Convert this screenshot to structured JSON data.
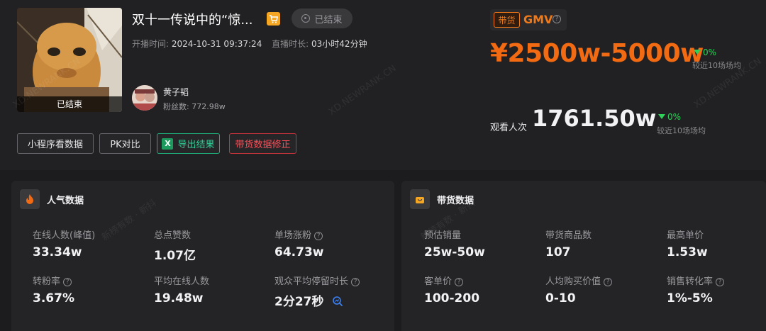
{
  "live": {
    "title": "双十一传说中的“惊...",
    "status": "已结束",
    "thumbnail_badge": "已结束",
    "start_label": "开播时间:",
    "start_time": "2024-10-31 09:37:24",
    "duration_label": "直播时长:",
    "duration": "03小时42分钟"
  },
  "anchor": {
    "name": "黄子韬",
    "fans_label": "粉丝数:",
    "fans": "772.98w"
  },
  "actions": {
    "mini_program": "小程序看数据",
    "pk": "PK对比",
    "export": "导出结果",
    "fix": "带货数据修正"
  },
  "gmv": {
    "tag": "带货",
    "label": "GMV",
    "value": "¥2500w-5000w",
    "delta": "0%",
    "compare": "较近10场场均"
  },
  "viewers": {
    "label": "观看人次",
    "value": "1761.50w",
    "delta": "0%",
    "compare": "较近10场场均"
  },
  "watermark": "XD.NEWRANK.CN",
  "popularity": {
    "title": "人气数据",
    "stats": [
      {
        "label": "在线人数(峰值)",
        "value": "33.34w"
      },
      {
        "label": "总点赞数",
        "value": "1.07亿"
      },
      {
        "label": "单场涨粉",
        "value": "64.73w"
      },
      {
        "label": "转粉率",
        "value": "3.67%"
      },
      {
        "label": "平均在线人数",
        "value": "19.48w"
      },
      {
        "label": "观众平均停留时长",
        "value": "2分27秒"
      }
    ]
  },
  "sales": {
    "title": "带货数据",
    "stats": [
      {
        "label": "预估销量",
        "value": "25w-50w"
      },
      {
        "label": "带货商品数",
        "value": "107"
      },
      {
        "label": "最高单价",
        "value": "1.53w"
      },
      {
        "label": "客单价",
        "value": "100-200"
      },
      {
        "label": "人均购买价值",
        "value": "0-10"
      },
      {
        "label": "销售转化率",
        "value": "1%-5%"
      }
    ]
  },
  "colors": {
    "accent": "#f26a12",
    "up": "#2fd15a",
    "export": "#2ed39a",
    "danger": "#ff4d57"
  }
}
